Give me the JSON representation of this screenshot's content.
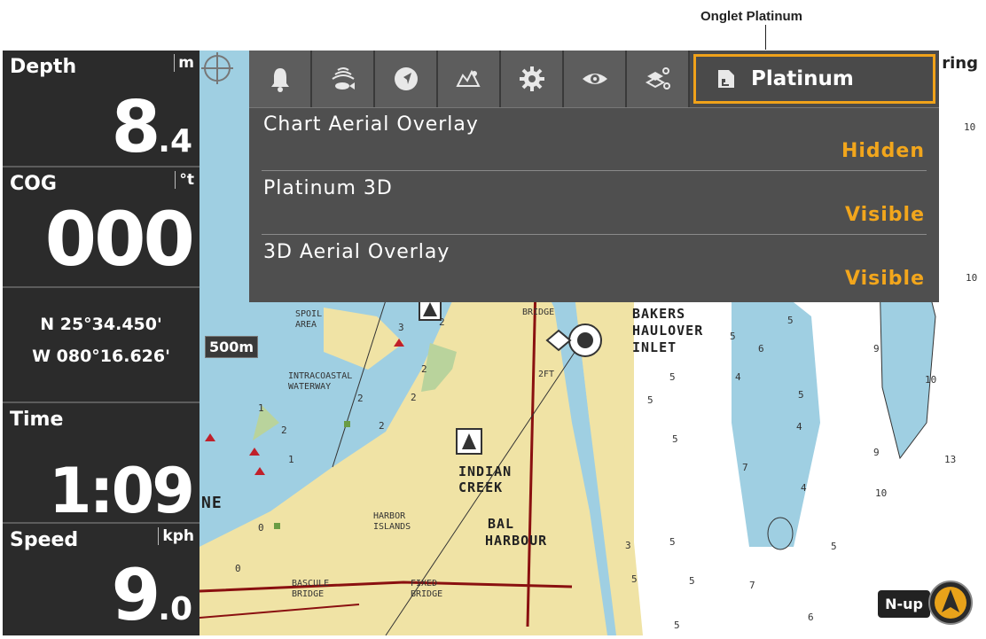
{
  "callout": {
    "label": "Onglet Platinum"
  },
  "sidebar": {
    "depth": {
      "title": "Depth",
      "unit": "m",
      "value_main": "8",
      "value_dec": ".4"
    },
    "cog": {
      "title": "COG",
      "unit": "°t",
      "value": "000"
    },
    "position": {
      "lat": "N 25°34.450'",
      "lon": "W 080°16.626'"
    },
    "time": {
      "title": "Time",
      "value": "1:09"
    },
    "speed": {
      "title": "Speed",
      "unit": "kph",
      "value_main": "9",
      "value_dec": ".0"
    }
  },
  "toolbar": {
    "icons": [
      "bell-icon",
      "fish-sonar-icon",
      "navigation-icon",
      "chart-icon",
      "gear-icon",
      "eye-icon",
      "layers-icon"
    ],
    "active_tab_label": "Platinum",
    "right_fragment": "ring"
  },
  "menu": {
    "items": [
      {
        "label": "Chart Aerial Overlay",
        "value": "Hidden"
      },
      {
        "label": "Platinum 3D",
        "value": "Visible"
      },
      {
        "label": "3D Aerial Overlay",
        "value": "Visible"
      }
    ]
  },
  "map": {
    "scale": "500m",
    "orientation": "N-up",
    "place_labels": {
      "bakers": "BAKERS",
      "haulover": "HAULOVER",
      "inlet": "INLET",
      "indian": "INDIAN",
      "creek": "CREEK",
      "bal": "BAL",
      "harbour": "HARBOUR",
      "intracoastal": "INTRACOASTAL",
      "waterway": "WATERWAY",
      "spoil": "SPOIL",
      "area": "AREA",
      "harbor": "HARBOR",
      "islands": "ISLANDS",
      "bascule": "BASCULE",
      "bridge1": "BRIDGE",
      "fixed": "FIXED",
      "bridge2": "BRIDGE",
      "bridge_top": "BRIDGE",
      "ft2": "2FT",
      "ne": "NE"
    },
    "depths": [
      "10",
      "3",
      "10",
      "5",
      "6",
      "9",
      "10",
      "5",
      "4",
      "5",
      "5",
      "5",
      "4",
      "9",
      "13",
      "7",
      "4",
      "10",
      "5",
      "5",
      "5",
      "5",
      "5",
      "7",
      "6",
      "5",
      "3",
      "2",
      "2",
      "1",
      "2",
      "2",
      "2",
      "2",
      "1",
      "0",
      "0",
      "3"
    ],
    "colors": {
      "land": "#f0e3a5",
      "shallow": "#9fcfe2",
      "deep": "#ffffff",
      "green": "#b9d39c",
      "road": "#8a1010"
    }
  }
}
